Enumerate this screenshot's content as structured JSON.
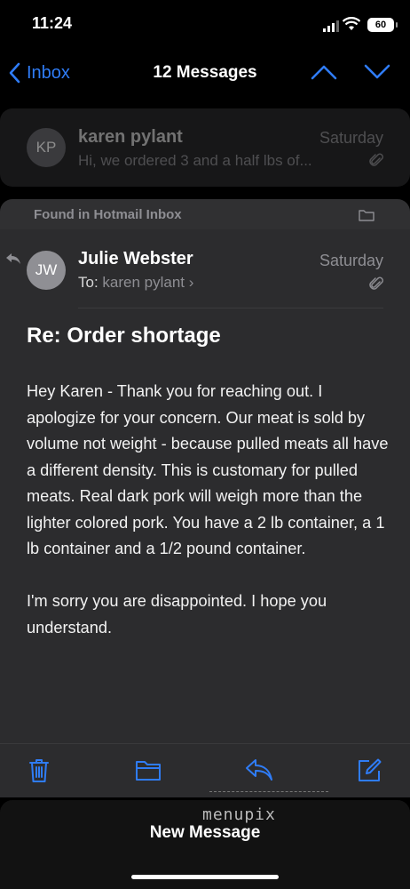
{
  "status_bar": {
    "time": "11:24",
    "battery": "60"
  },
  "nav": {
    "back_label": "Inbox",
    "title": "12 Messages"
  },
  "previous_message": {
    "initials": "KP",
    "sender": "karen pylant",
    "date": "Saturday",
    "preview": "Hi, we ordered 3 and a half lbs of..."
  },
  "found_banner": {
    "text": "Found in Hotmail Inbox"
  },
  "message": {
    "initials": "JW",
    "sender": "Julie Webster",
    "date": "Saturday",
    "to_label": "To:",
    "to_name": "karen pylant",
    "subject": "Re: Order shortage",
    "body": [
      "Hey Karen - Thank you for reaching out. I apologize for your concern.  Our meat is sold by volume not weight - because pulled meats all have a different density. This is customary for pulled meats.  Real dark pork will weigh more than the lighter colored pork.  You have a 2 lb container, a 1 lb container and a 1/2 pound container.",
      "I'm sorry you are disappointed.  I hope you understand."
    ]
  },
  "toolbar": {
    "icons": [
      "trash-icon",
      "folder-icon",
      "reply-icon",
      "compose-icon"
    ]
  },
  "bottom": {
    "new_message_label": "New Message",
    "watermark": "menupix"
  },
  "colors": {
    "accent": "#2f7cf6",
    "card": "#2c2c2e",
    "background": "#000000"
  }
}
